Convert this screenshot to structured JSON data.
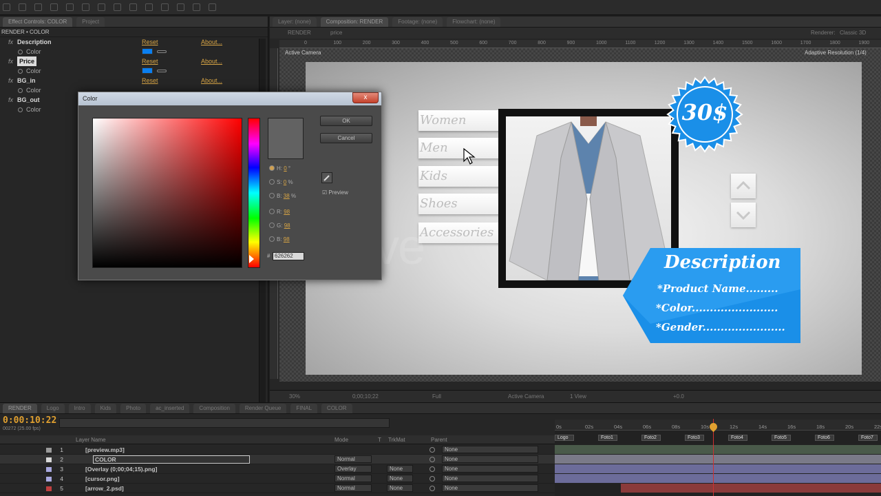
{
  "effect_controls": {
    "tabs": [
      "Effect Controls: COLOR",
      "Project"
    ],
    "breadcrumb": "RENDER • COLOR",
    "effects": [
      {
        "name": "Description",
        "reset": "Reset",
        "about": "About...",
        "sub": "Color"
      },
      {
        "name": "Price",
        "reset": "Reset",
        "about": "About...",
        "sub": "Color"
      },
      {
        "name": "BG_in",
        "reset": "Reset",
        "about": "About...",
        "sub": "Color"
      },
      {
        "name": "BG_out",
        "reset": "",
        "about": "",
        "sub": "Color"
      }
    ],
    "swatch_color": "#0a7ff0"
  },
  "composition": {
    "tabs": [
      "Layer: (none)",
      "Composition: RENDER",
      "Footage: (none)",
      "Flowchart: (none)"
    ],
    "crumbs": [
      "RENDER",
      "price"
    ],
    "renderer_label": "Renderer:",
    "renderer_value": "Classic 3D",
    "camera": "Active Camera",
    "resolution": "Adaptive Resolution (1/4)",
    "ruler_ticks": [
      "0",
      "100",
      "200",
      "300",
      "400",
      "500",
      "600",
      "700",
      "800",
      "900",
      "1000",
      "1100",
      "1200",
      "1300",
      "1400",
      "1500",
      "1600",
      "1700",
      "1800",
      "1900"
    ],
    "bottom": {
      "zoom": "30%",
      "time": "0;00;10;22",
      "quality": "Full",
      "view": "Active Camera",
      "views": "1 View",
      "offset": "+0.0"
    }
  },
  "scene": {
    "categories": [
      "Women",
      "Men",
      "Kids",
      "Shoes",
      "Accessories"
    ],
    "price": "30$",
    "desc_title": "Description",
    "desc_lines": [
      "*Product Name.........",
      "*Color........................",
      "*Gender......................."
    ],
    "accent": "#1a8fe8",
    "watermark": "videohive"
  },
  "color_dialog": {
    "title": "Color",
    "close": "x",
    "ok": "OK",
    "cancel": "Cancel",
    "preview": "Preview",
    "fields": [
      {
        "key": "H:",
        "val": "0",
        "unit": "°"
      },
      {
        "key": "S:",
        "val": "0",
        "unit": "%"
      },
      {
        "key": "B:",
        "val": "38",
        "unit": "%"
      },
      {
        "key": "R:",
        "val": "98",
        "unit": ""
      },
      {
        "key": "G:",
        "val": "98",
        "unit": ""
      },
      {
        "key": "B:",
        "val": "98",
        "unit": ""
      }
    ],
    "hex_label": "#",
    "hex": "626262",
    "current_color": "#626262"
  },
  "timeline": {
    "tabs": [
      "RENDER",
      "Logo",
      "Intro",
      "Kids",
      "Photo",
      "ac_inserted",
      "Composition",
      "Render Queue",
      "FINAL",
      "COLOR"
    ],
    "timecode": "0:00:10:22",
    "fps": "00272 (25.00 fps)",
    "headers": {
      "name": "Layer Name",
      "mode": "Mode",
      "t": "T",
      "trkmat": "TrkMat",
      "parent": "Parent"
    },
    "layers": [
      {
        "num": "1",
        "name": "[preview.mp3]",
        "mode": "",
        "trkmat": "",
        "parent": "None",
        "color": "#9a9a9a"
      },
      {
        "num": "2",
        "name": "COLOR",
        "mode": "Normal",
        "trkmat": "",
        "parent": "None",
        "color": "#d8d8d8"
      },
      {
        "num": "3",
        "name": "[Overlay (0;00;04;15).png]",
        "mode": "Overlay",
        "trkmat": "None",
        "parent": "None",
        "color": "#a9a9e0"
      },
      {
        "num": "4",
        "name": "[cursor.png]",
        "mode": "Normal",
        "trkmat": "None",
        "parent": "None",
        "color": "#a9a9e0"
      },
      {
        "num": "5",
        "name": "[arrow_2.psd]",
        "mode": "Normal",
        "trkmat": "None",
        "parent": "None",
        "color": "#c04040"
      }
    ],
    "ruler": [
      "0s",
      "02s",
      "04s",
      "06s",
      "08s",
      "10s",
      "12s",
      "14s",
      "16s",
      "18s",
      "20s",
      "22s"
    ],
    "markers": [
      "Logo",
      "Foto1",
      "Foto2",
      "Foto3",
      "Foto4",
      "Foto5",
      "Foto6",
      "Foto7"
    ]
  }
}
